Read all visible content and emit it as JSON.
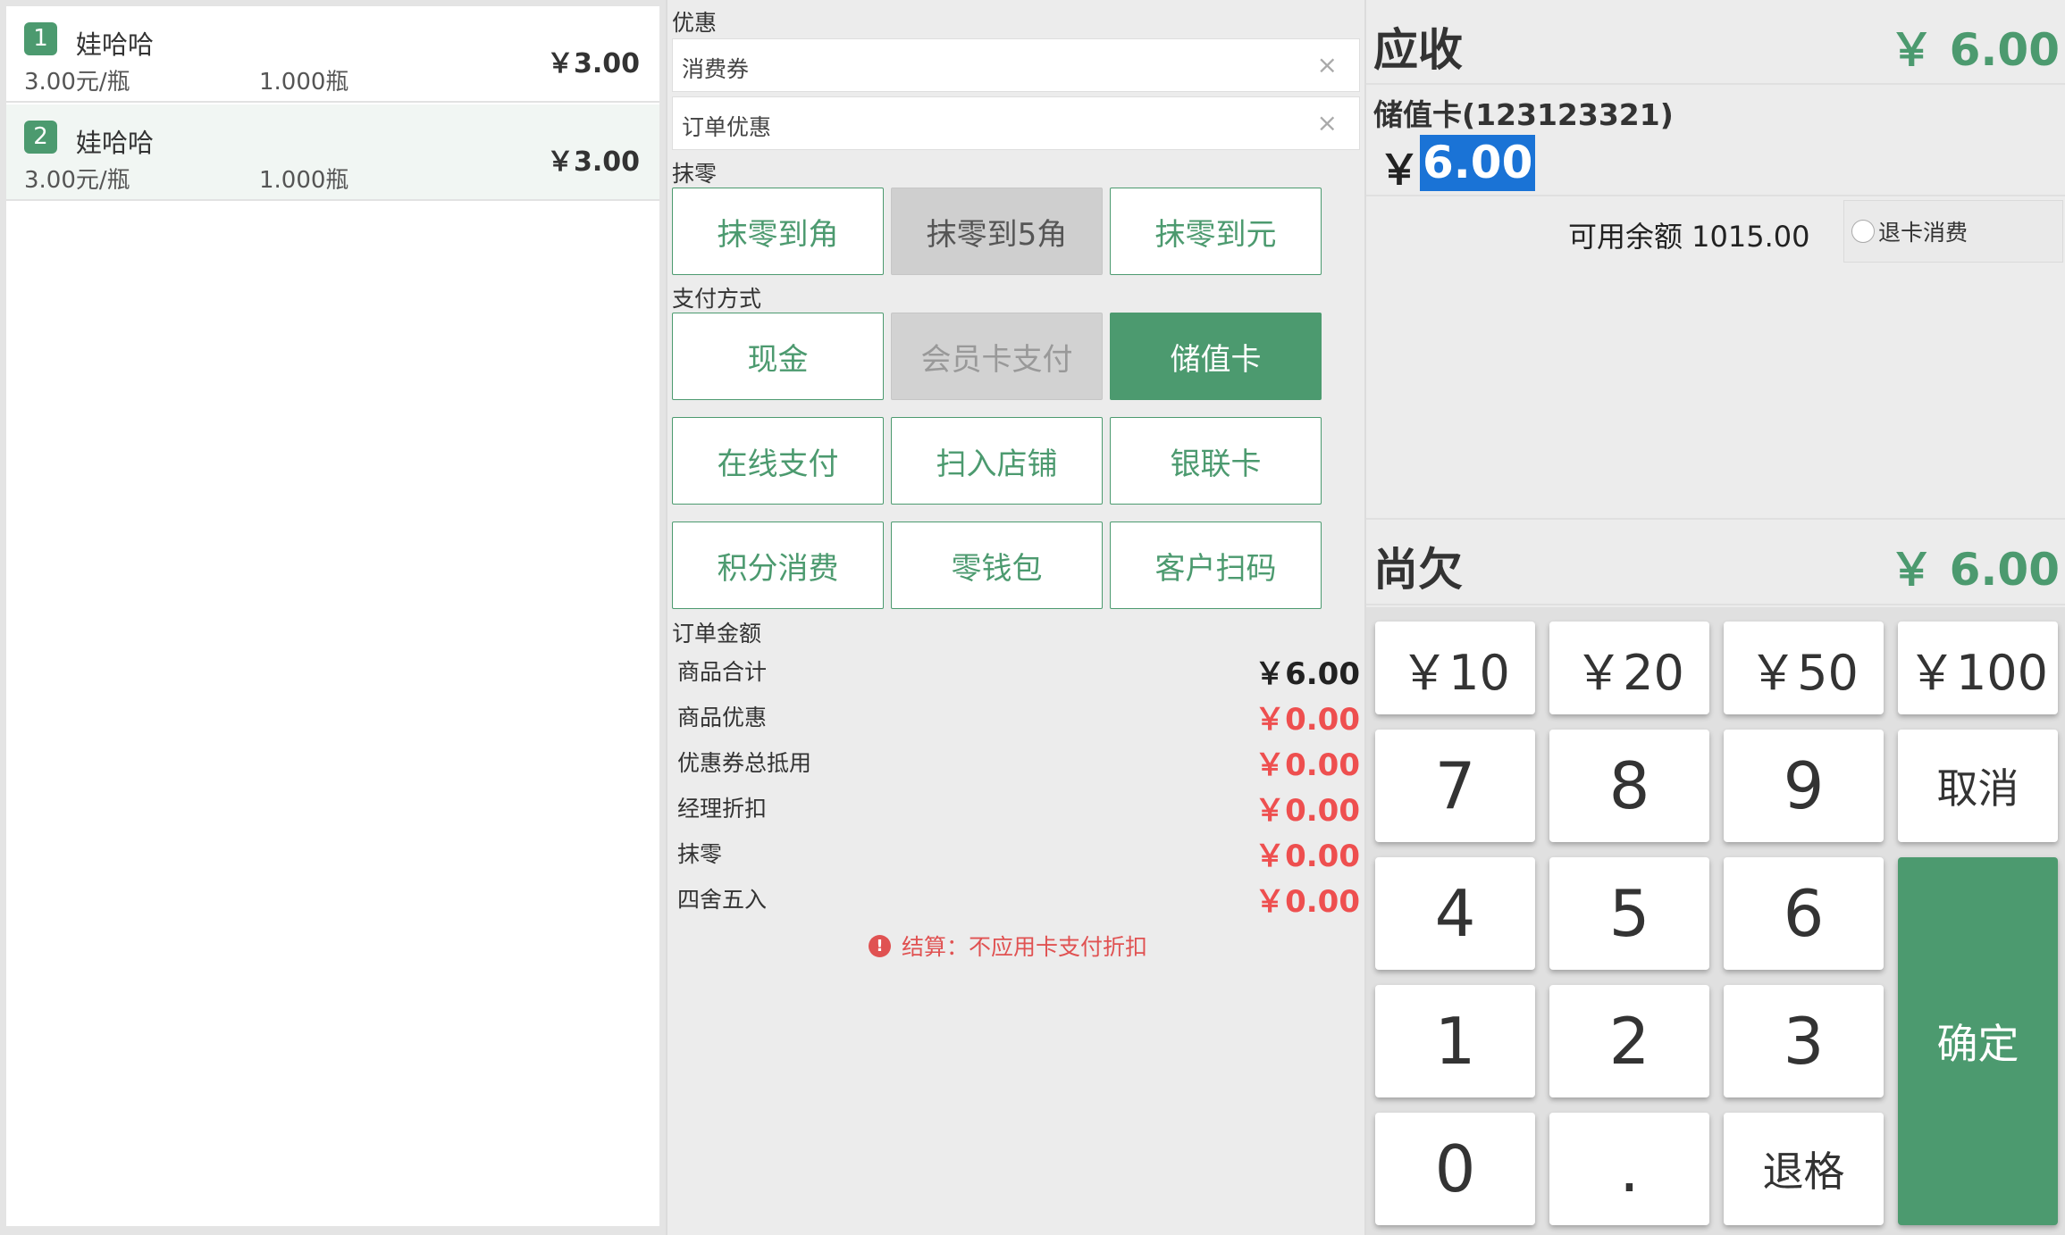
{
  "order_items": [
    {
      "index": "1",
      "name": "娃哈哈",
      "unit_price": "3.00元/瓶",
      "qty": "1.000瓶",
      "total": "￥3.00"
    },
    {
      "index": "2",
      "name": "娃哈哈",
      "unit_price": "3.00元/瓶",
      "qty": "1.000瓶",
      "total": "￥3.00"
    }
  ],
  "discount": {
    "section_label": "优惠",
    "coupon_field": "消费券",
    "order_discount_field": "订单优惠",
    "clear_glyph": "×"
  },
  "rounding": {
    "section_label": "抹零",
    "options": [
      "抹零到角",
      "抹零到5角",
      "抹零到元"
    ]
  },
  "payment": {
    "section_label": "支付方式",
    "methods": [
      "现金",
      "会员卡支付",
      "储值卡",
      "在线支付",
      "扫入店铺",
      "银联卡",
      "积分消费",
      "零钱包",
      "客户扫码"
    ]
  },
  "order_amount": {
    "section_label": "订单金额",
    "rows": [
      {
        "label": "商品合计",
        "value": "￥6.00"
      },
      {
        "label": "商品优惠",
        "value": "￥0.00"
      },
      {
        "label": "优惠券总抵用",
        "value": "￥0.00"
      },
      {
        "label": "经理折扣",
        "value": "￥0.00"
      },
      {
        "label": "抹零",
        "value": "￥0.00"
      },
      {
        "label": "四舍五入",
        "value": "￥0.00"
      }
    ],
    "note_icon": "!",
    "note": "结算：不应用卡支付折扣"
  },
  "summary": {
    "due_label": "应收",
    "due_amount": "￥ 6.00",
    "card_label": "储值卡(123123321)",
    "currency": "￥",
    "card_amount": "6.00",
    "balance": "可用余额 1015.00",
    "refund_label": "退卡消费",
    "owe_label": "尚欠",
    "owe_amount": "￥ 6.00"
  },
  "keypad": {
    "money": [
      "￥10",
      "￥20",
      "￥50",
      "￥100"
    ],
    "digits": [
      "7",
      "8",
      "9",
      "4",
      "5",
      "6",
      "1",
      "2",
      "3",
      "0",
      "."
    ],
    "cancel": "取消",
    "confirm": "确定",
    "backspace": "退格"
  },
  "colors": {
    "accent": "#4c9a6f",
    "negative": "#ee4f4f",
    "selection": "#1a73d6"
  }
}
